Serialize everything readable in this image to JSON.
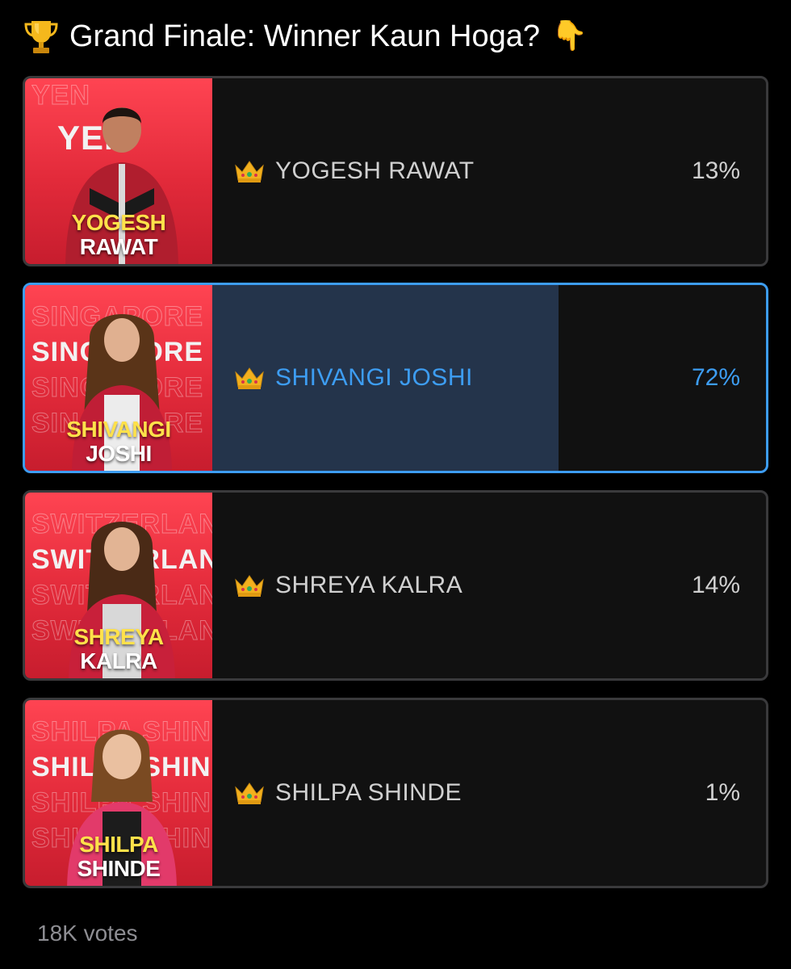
{
  "poll": {
    "question": "Grand Finale: Winner Kaun Hoga?",
    "leading_emoji": "🏆",
    "trailing_emoji": "👇",
    "votes_label": "18K votes",
    "accent_color": "#3d9df2"
  },
  "options": [
    {
      "label": "YOGESH RAWAT",
      "percent": 13,
      "percent_label": "13%",
      "selected": false,
      "icon": "crown-icon",
      "photo": {
        "first": "YOGESH",
        "last": "RAWAT",
        "bg_word": "YEN"
      }
    },
    {
      "label": "SHIVANGI JOSHI",
      "percent": 72,
      "percent_label": "72%",
      "selected": true,
      "icon": "crown-icon",
      "photo": {
        "first": "SHIVANGI",
        "last": "JOSHI",
        "bg_word": "SINGAPORE"
      }
    },
    {
      "label": "SHREYA KALRA",
      "percent": 14,
      "percent_label": "14%",
      "selected": false,
      "icon": "crown-icon",
      "photo": {
        "first": "SHREYA",
        "last": "KALRA",
        "bg_word": "SWITZERLAND"
      }
    },
    {
      "label": "SHILPA SHINDE",
      "percent": 1,
      "percent_label": "1%",
      "selected": false,
      "icon": "crown-icon",
      "photo": {
        "first": "SHILPA",
        "last": "SHINDE",
        "bg_word": "SHILPA SHINDE"
      }
    }
  ]
}
